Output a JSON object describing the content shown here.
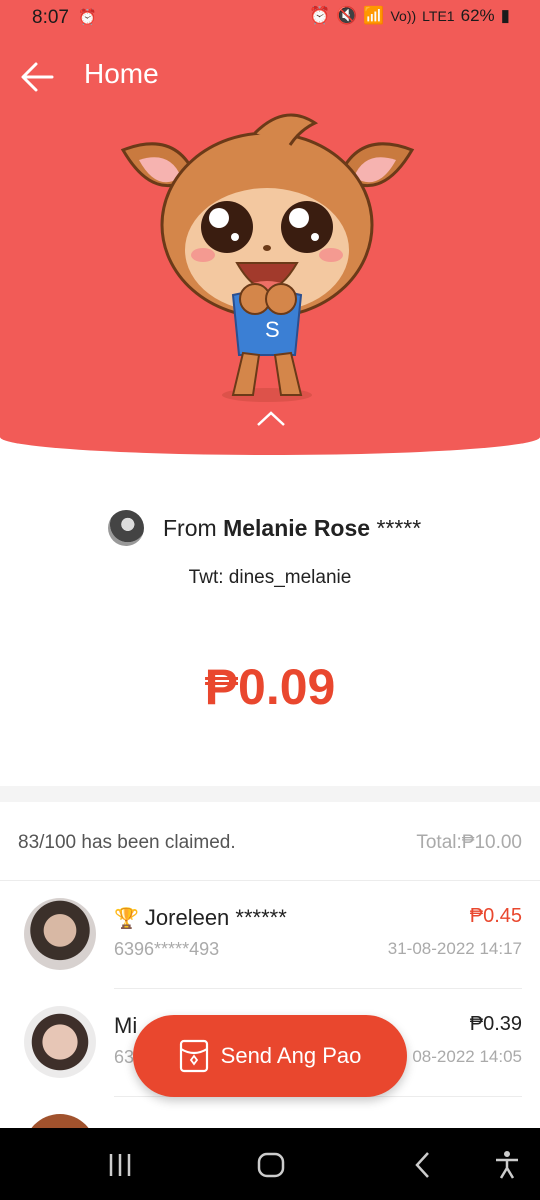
{
  "status_bar": {
    "time": "8:07",
    "volte": "Vo))",
    "lte": "LTE1",
    "battery": "62%"
  },
  "header": {
    "title": "Home",
    "back_icon": "arrow-left-icon",
    "background_color": "#f25b57"
  },
  "sender": {
    "from_label": "From ",
    "name": "Melanie Rose",
    "masked": " *****",
    "twitter": "Twt: dines_melanie"
  },
  "amount": "₱0.09",
  "claims": {
    "status": "83/100 has been claimed.",
    "total": "Total:₱10.00"
  },
  "recipients": [
    {
      "name": "Joreleen ******",
      "phone": "6396*****493",
      "amount": "₱0.45",
      "date": "31-08-2022 14:17",
      "top": true
    },
    {
      "name": "Mi",
      "phone": "63",
      "amount": "₱0.39",
      "date": "08-2022 14:05",
      "top": false
    },
    {
      "name": "",
      "phone": "",
      "amount": "",
      "date": "",
      "top": false
    }
  ],
  "send_button": {
    "label": "Send Ang Pao"
  },
  "colors": {
    "accent": "#e9472e",
    "hero": "#f25b57"
  }
}
